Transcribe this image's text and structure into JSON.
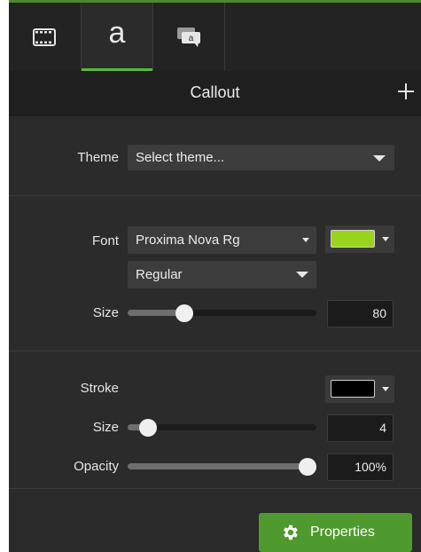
{
  "tabs": [
    {
      "icon": "film-strip-icon"
    },
    {
      "icon": "annotation-a-icon",
      "glyph": "a",
      "active": true
    },
    {
      "icon": "callout-bubble-icon"
    }
  ],
  "header": {
    "title": "Callout",
    "add_icon": "plus-icon"
  },
  "theme": {
    "label": "Theme",
    "value": "Select theme..."
  },
  "font": {
    "label": "Font",
    "family": "Proxima Nova Rg",
    "color": "#9ad31c",
    "style": "Regular",
    "size_label": "Size",
    "size_value": "80",
    "size_fraction": 0.3
  },
  "stroke": {
    "label": "Stroke",
    "color": "#000000",
    "size_label": "Size",
    "size_value": "4",
    "size_fraction": 0.11,
    "opacity_label": "Opacity",
    "opacity_value": "100%",
    "opacity_fraction": 1.0
  },
  "footer": {
    "properties_label": "Properties",
    "properties_icon": "gear-icon"
  }
}
